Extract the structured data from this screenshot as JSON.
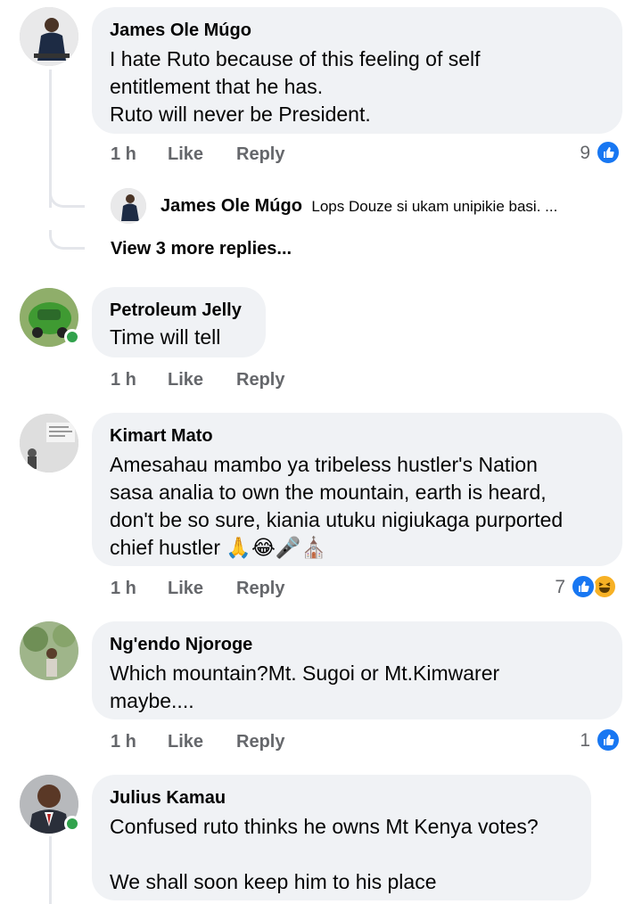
{
  "comments": [
    {
      "author": "James Ole Múgo",
      "text": "I hate Ruto because of this feeling of self\nentitlement that he has.\n    Ruto will never be President.",
      "time": "1 h",
      "like": "Like",
      "reply": "Reply",
      "reactions": "9",
      "reaction_icons": [
        "like-icon"
      ],
      "replies": {
        "preview_author": "James Ole Múgo",
        "preview_text": "Lops Douze si ukam unipikie basi. ...",
        "view_more": "View 3 more replies..."
      }
    },
    {
      "author": "Petroleum Jelly",
      "text": "Time will tell",
      "time": "1 h",
      "like": "Like",
      "reply": "Reply",
      "online": true
    },
    {
      "author": "Kimart Mato",
      "text": "Amesahau mambo ya tribeless hustler's Nation\nsasa analia to own the mountain, earth is heard,\ndon't be so sure, kiania utuku nigiukaga purported\nchief hustler 🙏😂🎤⛪",
      "time": "1 h",
      "like": "Like",
      "reply": "Reply",
      "reactions": "7",
      "reaction_icons": [
        "like-icon",
        "haha-icon"
      ]
    },
    {
      "author": "Ng'endo Njoroge",
      "text": " Which mountain?Mt. Sugoi or Mt.Kimwarer\nmaybe....",
      "time": "1 h",
      "like": "Like",
      "reply": "Reply",
      "reactions": "1",
      "reaction_icons": [
        "like-icon"
      ]
    },
    {
      "author": "Julius Kamau",
      "text": "Confused ruto thinks he owns Mt Kenya votes?\n\nWe shall soon keep him to his place",
      "online": true
    }
  ],
  "colors": {
    "bubble": "#f0f2f5",
    "meta": "#65676b",
    "like_blue": "#1877f2",
    "online_green": "#31a24c",
    "haha_yellow": "#f7b125"
  }
}
